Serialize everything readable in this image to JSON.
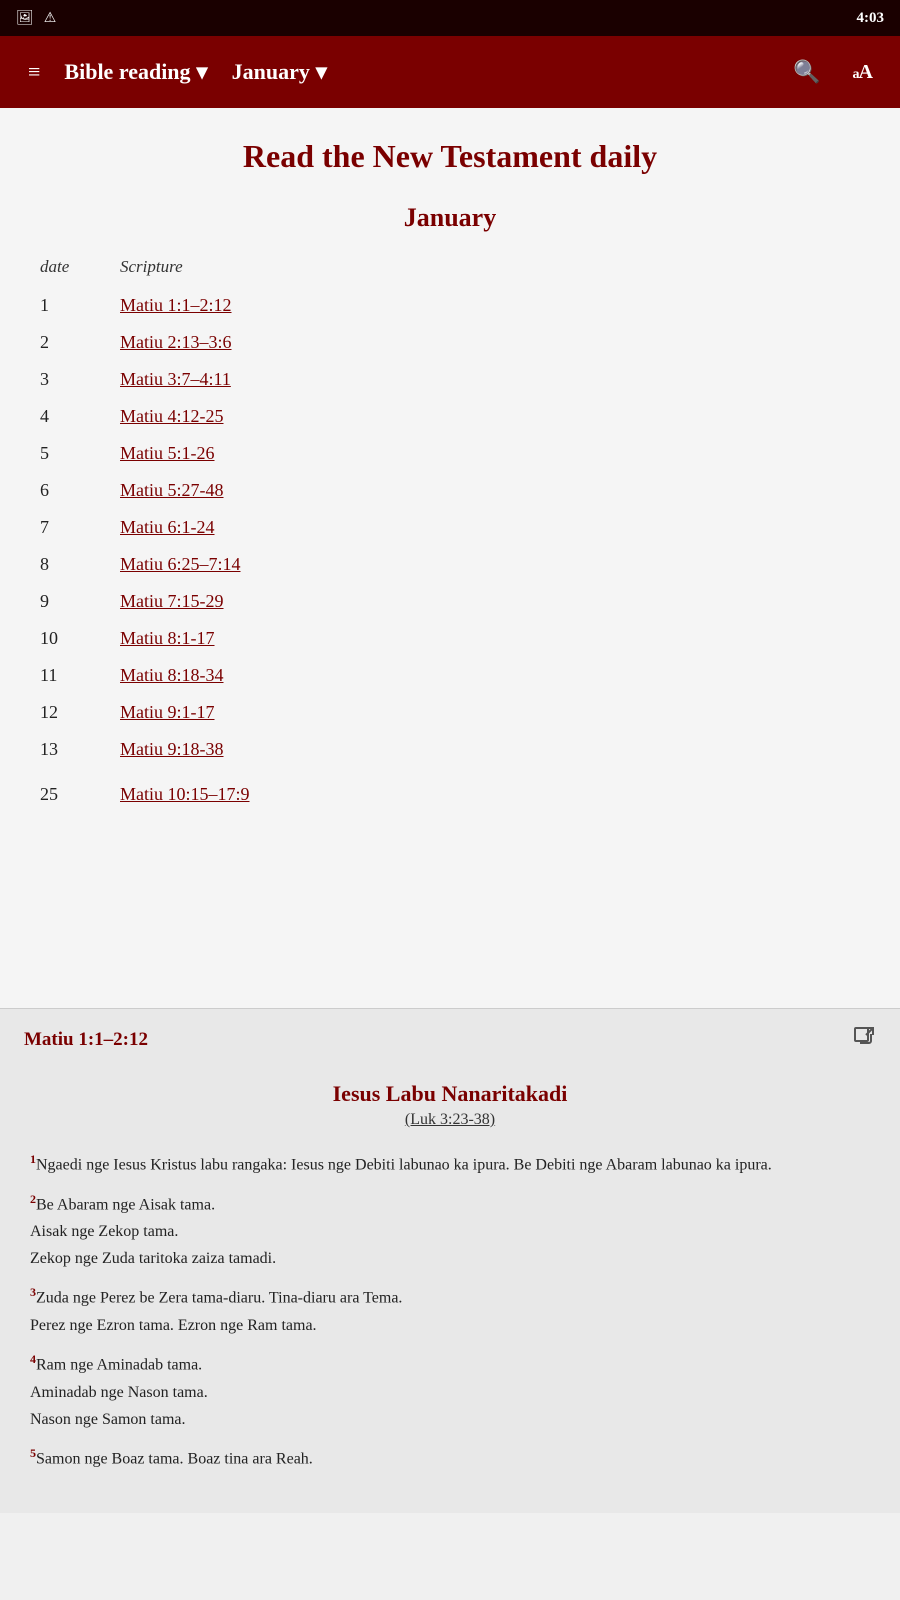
{
  "status_bar": {
    "time": "4:03",
    "icons": [
      "image-icon",
      "alert-icon"
    ]
  },
  "nav": {
    "menu_icon": "≡",
    "title": "Bible reading",
    "title_dropdown": "▾",
    "month": "January",
    "month_dropdown": "▾",
    "search_icon": "search",
    "font_icon": "aA"
  },
  "main": {
    "page_title": "Read the New Testament daily",
    "month_heading": "January",
    "table_headers": {
      "date": "date",
      "scripture": "Scripture"
    },
    "readings": [
      {
        "date": "1",
        "scripture": "Matiu 1:1–2:12"
      },
      {
        "date": "2",
        "scripture": "Matiu 2:13–3:6"
      },
      {
        "date": "3",
        "scripture": "Matiu 3:7–4:11"
      },
      {
        "date": "4",
        "scripture": "Matiu 4:12-25"
      },
      {
        "date": "5",
        "scripture": "Matiu 5:1-26"
      },
      {
        "date": "6",
        "scripture": "Matiu 5:27-48"
      },
      {
        "date": "7",
        "scripture": "Matiu 6:1-24"
      },
      {
        "date": "8",
        "scripture": "Matiu 6:25–7:14"
      },
      {
        "date": "9",
        "scripture": "Matiu 7:15-29"
      },
      {
        "date": "10",
        "scripture": "Matiu 8:1-17"
      },
      {
        "date": "11",
        "scripture": "Matiu 8:18-34"
      },
      {
        "date": "12",
        "scripture": "Matiu 9:1-17"
      },
      {
        "date": "13",
        "scripture": "Matiu 9:18-38"
      }
    ],
    "last_partial_date": "25",
    "last_partial_scripture": "Matiu 10:15–17:9"
  },
  "panel": {
    "title": "Matiu 1:1–2:12",
    "open_icon": "⧉",
    "passage_title": "Iesus Labu Nanaritakadi",
    "passage_subtitle": "(Luk 3:23-38)",
    "verses": [
      {
        "num": "1",
        "text": "Ngaedi nge Iesus Kristus labu rangaka: Iesus nge Debiti labunao ka ipura. Be Debiti nge Abaram labunao ka ipura."
      },
      {
        "num": "2",
        "lines": [
          "Be Abaram nge Aisak tama.",
          "Aisak nge Zekop tama.",
          "Zekop nge Zuda taritoka zaiza tamadi."
        ]
      },
      {
        "num": "3",
        "lines": [
          "Zuda nge Perez be Zera tama-diaru. Tina-diaru ara Tema.",
          "Perez nge Ezron tama. Ezron nge Ram tama."
        ]
      },
      {
        "num": "4",
        "lines": [
          "Ram nge Aminadab tama.",
          "Aminadab nge Nason tama.",
          "Nason nge Samon tama."
        ]
      },
      {
        "num": "5",
        "text": "Samon nge Boaz tama. Boaz tina ara Reah."
      }
    ]
  }
}
